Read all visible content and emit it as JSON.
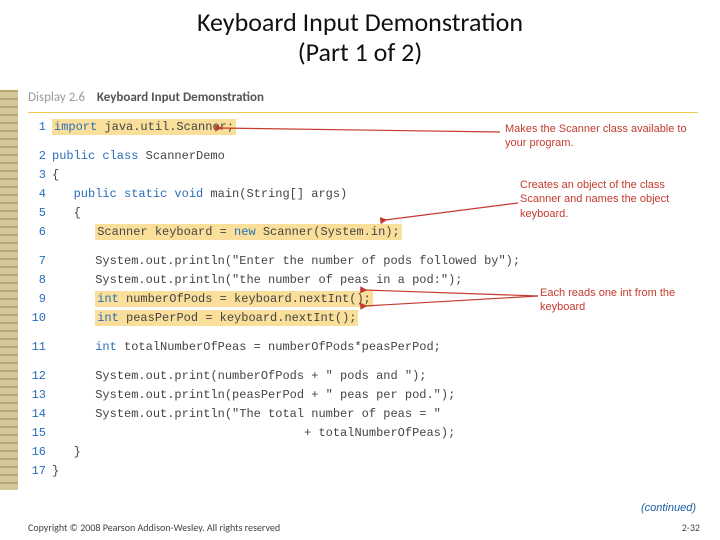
{
  "title_line1": "Keyboard Input Demonstration",
  "title_line2": "(Part 1 of 2)",
  "display_label": "Display 2.6",
  "display_title": "Keyboard Input Demonstration",
  "code": {
    "l1_kw": "import",
    "l1_rest": " java.util.Scanner;",
    "l2_kw": "public class",
    "l2_rest": " ScannerDemo",
    "l3": "{",
    "l4_kw": "public static void",
    "l4_rest": " main(String[] args)",
    "l5": "{",
    "l6_a": "Scanner keyboard = ",
    "l6_kw": "new",
    "l6_b": " Scanner(System.in);",
    "l7": "System.out.println(\"Enter the number of pods followed by\");",
    "l8": "System.out.println(\"the number of peas in a pod:\");",
    "l9_kw": "int",
    "l9_rest": " numberOfPods = keyboard.nextInt();",
    "l10_kw": "int",
    "l10_rest": " peasPerPod = keyboard.nextInt();",
    "l11_kw": "int",
    "l11_rest": " totalNumberOfPeas = numberOfPods*peasPerPod;",
    "l12": "System.out.print(numberOfPods + \" pods and \");",
    "l13": "System.out.println(peasPerPod + \" peas per pod.\");",
    "l14": "System.out.println(\"The total number of peas = \"",
    "l15": "                             + totalNumberOfPeas);",
    "l16": "}",
    "l17": "}"
  },
  "annot1": "Makes the Scanner class available to your program.",
  "annot2": "Creates an object of the class Scanner and names the object keyboard.",
  "annot3": "Each reads one int from the keyboard",
  "continued": "(continued)",
  "copyright": "Copyright © 2008 Pearson Addison-Wesley. All rights reserved",
  "page": "2-32"
}
